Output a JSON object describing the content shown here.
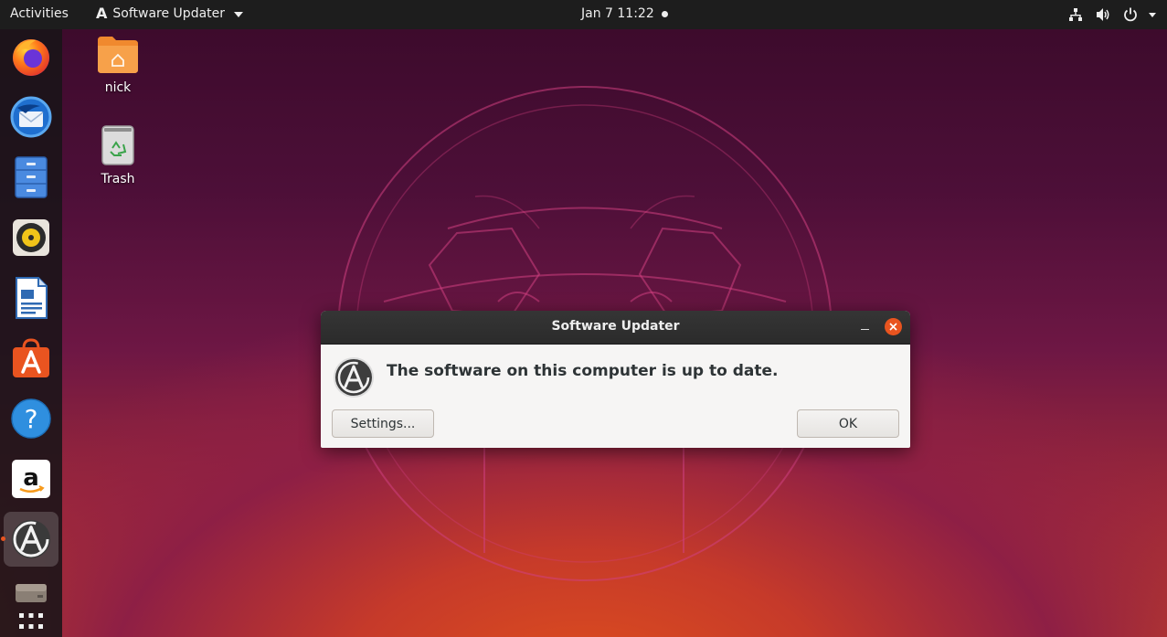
{
  "topbar": {
    "activities": "Activities",
    "app_menu_label": "Software Updater",
    "app_menu_icon": "software-updater-icon",
    "clock": "Jan 7   11:22",
    "tray": [
      {
        "name": "network-icon"
      },
      {
        "name": "volume-icon"
      },
      {
        "name": "power-icon"
      }
    ]
  },
  "dock": {
    "items": [
      {
        "name": "firefox-icon"
      },
      {
        "name": "thunderbird-icon"
      },
      {
        "name": "files-icon"
      },
      {
        "name": "rhythmbox-icon"
      },
      {
        "name": "libreoffice-writer-icon"
      },
      {
        "name": "ubuntu-software-icon"
      },
      {
        "name": "help-icon"
      },
      {
        "name": "amazon-icon"
      },
      {
        "name": "software-updater-icon",
        "active": true
      },
      {
        "name": "drive-icon"
      },
      {
        "name": "show-applications-icon"
      }
    ],
    "amazon_glyph": "a",
    "help_glyph": "?"
  },
  "desktop": {
    "home_label": "nick",
    "trash_label": "Trash"
  },
  "dialog": {
    "title": "Software Updater",
    "message": "The software on this computer is up to date.",
    "settings_button": "Settings...",
    "ok_button": "OK"
  },
  "colors": {
    "accent": "#e95420",
    "topbar": "#1d1d1d",
    "dialog_bg": "#f6f5f4"
  }
}
